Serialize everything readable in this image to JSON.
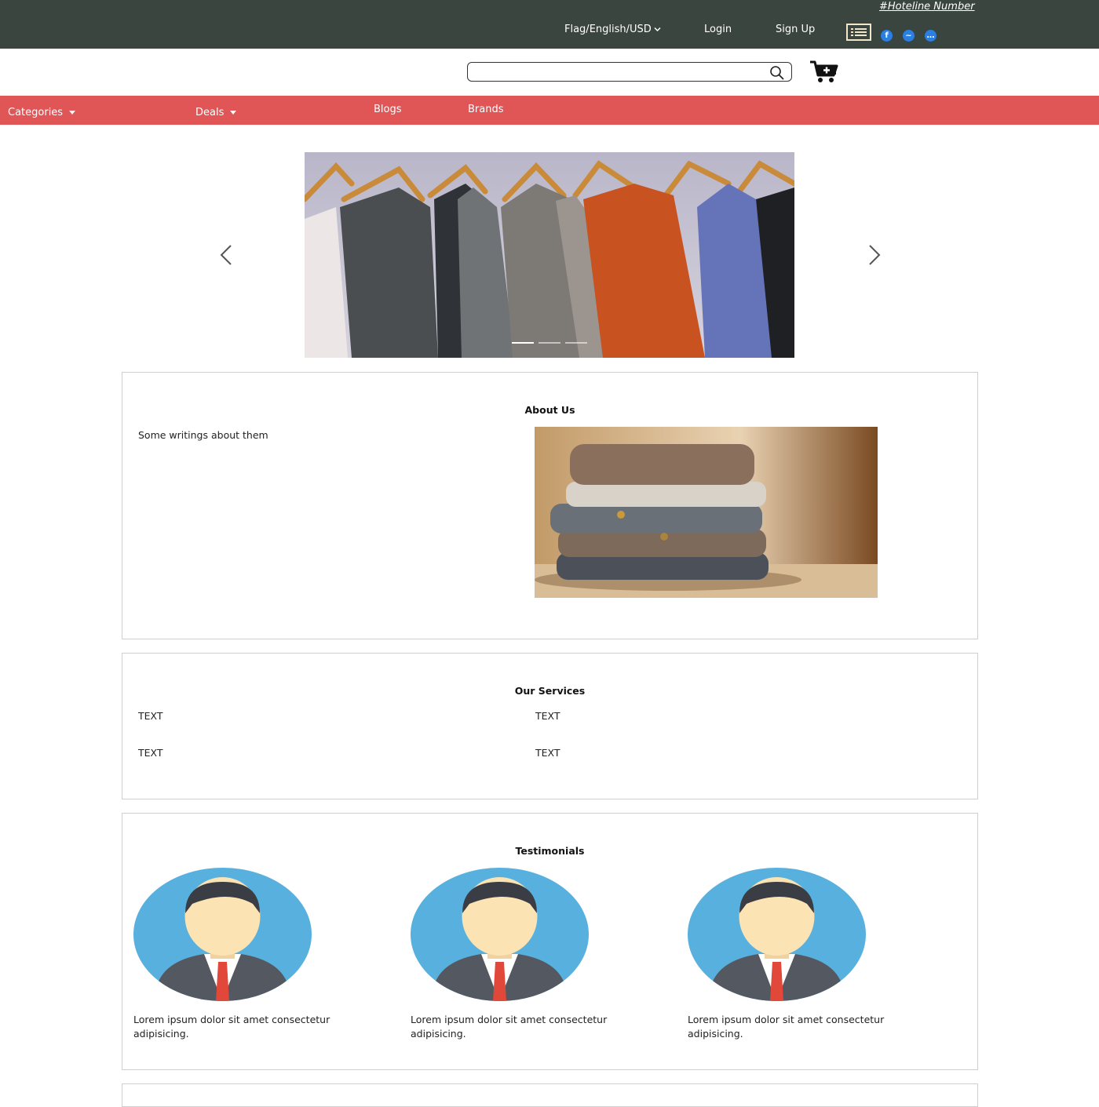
{
  "topbar": {
    "hotline": "#Hoteline Number",
    "language": "Flag/English/USD",
    "login": "Login",
    "signup": "Sign Up"
  },
  "search": {
    "placeholder": ""
  },
  "nav": {
    "categories": "Categories",
    "deals": "Deals",
    "blogs": "Blogs",
    "brands": "Brands"
  },
  "about": {
    "title": "About Us",
    "text": "Some writings about them"
  },
  "services": {
    "title": "Our Services",
    "items": [
      "TEXT",
      "TEXT",
      "TEXT",
      "TEXT"
    ]
  },
  "testimonials": {
    "title": "Testimonials",
    "items": [
      {
        "text": "Lorem ipsum dolor sit amet consectetur adipisicing."
      },
      {
        "text": "Lorem ipsum dolor sit amet consectetur adipisicing."
      },
      {
        "text": "Lorem ipsum dolor sit amet consectetur adipisicing."
      }
    ]
  },
  "colors": {
    "topbar": "#3a4540",
    "nav": "#e05556",
    "social": "#2a7fe0",
    "avatar_bg": "#58b0de"
  }
}
